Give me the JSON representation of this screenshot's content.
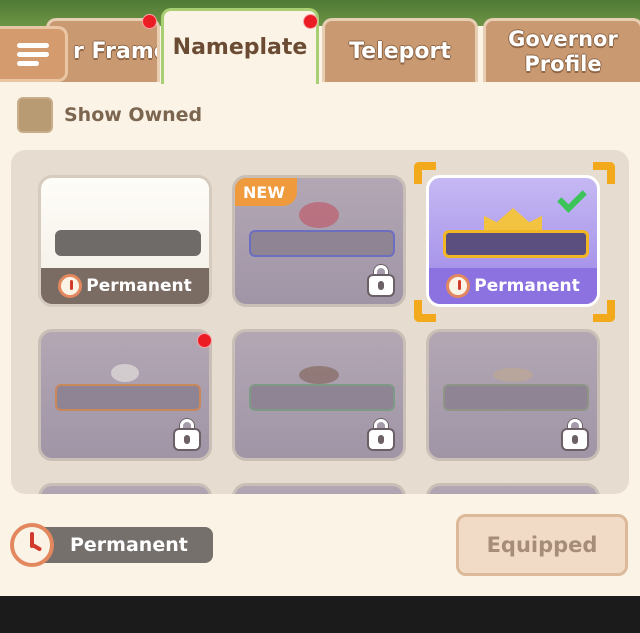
{
  "tabs": [
    {
      "label": "r Frame",
      "active": false,
      "dot": true
    },
    {
      "label": "Nameplate",
      "active": true,
      "dot": true
    },
    {
      "label": "Teleport",
      "active": false,
      "dot": false
    },
    {
      "label": "Governor Profile",
      "active": false,
      "dot": false
    }
  ],
  "filter": {
    "show_owned_label": "Show Owned",
    "checked": false
  },
  "items": [
    {
      "state": "owned",
      "band_label": "Permanent",
      "new": false,
      "locked": false,
      "equipped": false
    },
    {
      "state": "locked",
      "badge": "NEW",
      "new": true,
      "locked": true,
      "equipped": false
    },
    {
      "state": "equipped",
      "band_label": "Permanent",
      "new": false,
      "locked": false,
      "equipped": true
    },
    {
      "state": "locked",
      "dot": true,
      "locked": true
    },
    {
      "state": "locked",
      "locked": true
    },
    {
      "state": "locked",
      "locked": true
    }
  ],
  "bottom": {
    "duration_label": "Permanent",
    "equip_button_label": "Equipped"
  },
  "colors": {
    "accent": "#f2a91c",
    "tab_bg": "#c99a72",
    "panel_bg": "#e6dccf",
    "equipped_card": "#9c87e7"
  }
}
